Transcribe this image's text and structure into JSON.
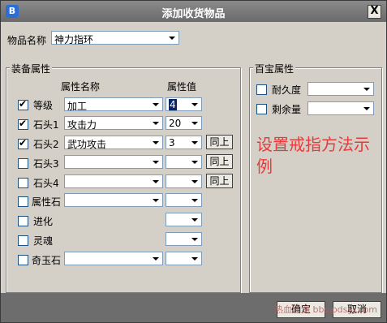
{
  "window": {
    "title": "添加收货物品",
    "icon": "app-icon",
    "close": "X"
  },
  "item_name": {
    "label": "物品名称",
    "value": "神力指环"
  },
  "equip_group": {
    "title": "装备属性",
    "col_name": "属性名称",
    "col_value": "属性值",
    "rows": [
      {
        "label": "等级",
        "checked": true,
        "name": "加工",
        "value": "4",
        "has_same": false
      },
      {
        "label": "石头1",
        "checked": true,
        "name": "攻击力",
        "value": "20",
        "has_same": false
      },
      {
        "label": "石头2",
        "checked": true,
        "name": "武功攻击",
        "value": "3",
        "has_same": true
      },
      {
        "label": "石头3",
        "checked": false,
        "name": "",
        "value": "",
        "has_same": true
      },
      {
        "label": "石头4",
        "checked": false,
        "name": "",
        "value": "",
        "has_same": true
      },
      {
        "label": "属性石",
        "checked": false,
        "name": "",
        "value": "",
        "has_same": false
      },
      {
        "label": "进化",
        "checked": false,
        "value": ""
      },
      {
        "label": "灵魂",
        "checked": false,
        "value": ""
      },
      {
        "label": "奇玉石",
        "checked": false,
        "name": "",
        "value": ""
      }
    ],
    "same_label": "同上"
  },
  "treasure_group": {
    "title": "百宝属性",
    "durability": {
      "label": "耐久度",
      "checked": false,
      "value": ""
    },
    "remaining": {
      "label": "剩余量",
      "checked": false,
      "value": ""
    }
  },
  "annotation": "设置戒指方法示例",
  "buttons": {
    "ok": "确定",
    "cancel": "取消"
  },
  "watermark": "热血江湖 bbs.pdsyj.com"
}
